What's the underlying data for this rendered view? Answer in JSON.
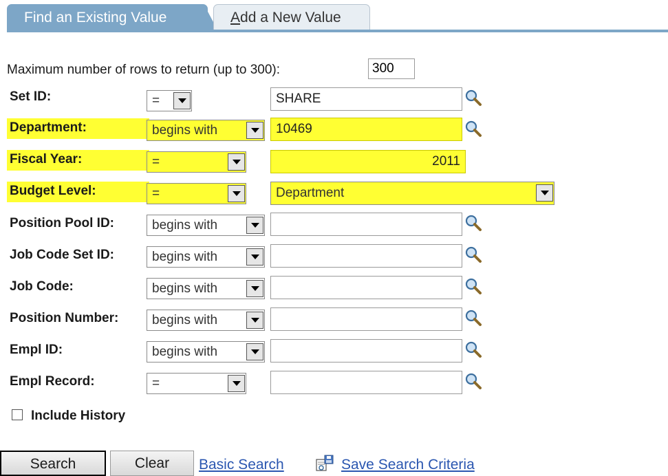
{
  "tabs": {
    "active": "Find an Existing Value",
    "inactive_first_letter": "A",
    "inactive_rest": "dd a New Value"
  },
  "max_rows": {
    "label": "Maximum number of rows to return (up to 300):",
    "value": "300"
  },
  "fields": [
    {
      "label": "Set ID:",
      "operator": "=",
      "value": "SHARE"
    },
    {
      "label": "Department:",
      "operator": "begins with",
      "value": "10469"
    },
    {
      "label": "Fiscal Year:",
      "operator": "=",
      "value": "2011"
    },
    {
      "label": "Budget Level:",
      "operator": "=",
      "value": "Department"
    },
    {
      "label": "Position Pool ID:",
      "operator": "begins with",
      "value": ""
    },
    {
      "label": "Job Code Set ID:",
      "operator": "begins with",
      "value": ""
    },
    {
      "label": "Job Code:",
      "operator": "begins with",
      "value": ""
    },
    {
      "label": "Position Number:",
      "operator": "begins with",
      "value": ""
    },
    {
      "label": "Empl ID:",
      "operator": "begins with",
      "value": ""
    },
    {
      "label": "Empl Record:",
      "operator": "=",
      "value": ""
    }
  ],
  "include_history": {
    "label": "Include History",
    "checked": false
  },
  "buttons": {
    "search": "Search",
    "clear": "Clear"
  },
  "links": {
    "basic_search": "Basic Search",
    "save_search": "Save Search Criteria"
  },
  "icons": {
    "lookup": "magnifier-icon",
    "save": "save-search-icon"
  },
  "colors": {
    "highlight": "#ffff33",
    "tab": "#7da6c7",
    "link": "#2a56b0"
  }
}
